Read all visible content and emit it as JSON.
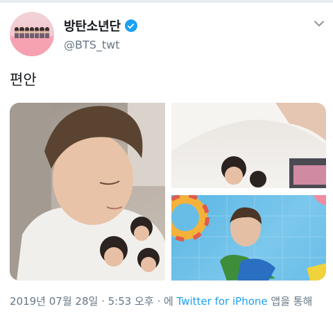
{
  "tweet": {
    "display_name": "방탄소년단",
    "handle": "@BTS_twt",
    "text": "편안",
    "verified": true,
    "avatar_icon": "profile-avatar",
    "menu_icon": "chevron-down-icon"
  },
  "media": {
    "count": 3,
    "items": [
      "photo-selfie",
      "photo-shirt",
      "photo-pool-illustration"
    ]
  },
  "meta": {
    "date": "2019년 07월 28일",
    "separator": " · ",
    "time": "5:53 오후",
    "via_prefix": " · 에 ",
    "source": "Twitter for iPhone",
    "via_suffix": " 앱을 통해"
  },
  "colors": {
    "accent": "#1da1f2",
    "text_primary": "#14171a",
    "text_secondary": "#657786"
  }
}
